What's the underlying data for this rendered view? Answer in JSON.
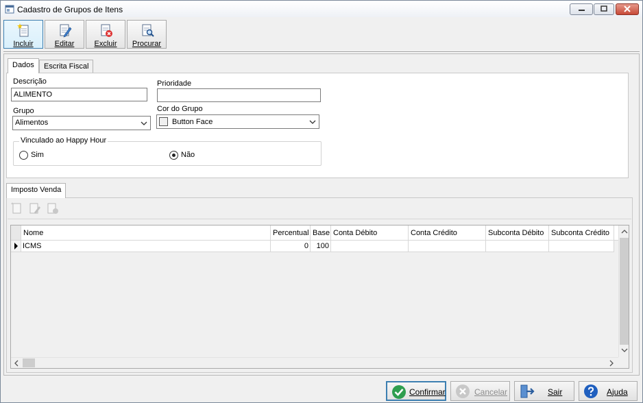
{
  "window": {
    "title": "Cadastro de Grupos de Itens"
  },
  "toolbar": {
    "incluir": "Incluir",
    "editar": "Editar",
    "excluir": "Excluir",
    "procurar": "Procurar"
  },
  "tabs": {
    "dados": "Dados",
    "escrita_fiscal": "Escrita Fiscal"
  },
  "form": {
    "descricao_label": "Descrição",
    "descricao_value": "ALIMENTO",
    "prioridade_label": "Prioridade",
    "prioridade_value": "",
    "grupo_label": "Grupo",
    "grupo_value": "Alimentos",
    "cor_label": "Cor do Grupo",
    "cor_value": "Button Face",
    "happy_hour_label": "Vinculado ao Happy Hour",
    "radio_sim": "Sim",
    "radio_nao": "Não",
    "happy_hour_selected": "Não"
  },
  "imposto_tab": "Imposto Venda",
  "grid": {
    "columns": [
      "Nome",
      "Percentual",
      "Base",
      "Conta Débito",
      "Conta Crédito",
      "Subconta Débito",
      "Subconta Crédito"
    ],
    "rows": [
      {
        "nome": "ICMS",
        "percentual": "0",
        "base": "100",
        "conta_debito": "",
        "conta_credito": "",
        "subconta_debito": "",
        "subconta_credito": ""
      }
    ]
  },
  "buttons": {
    "confirmar": "Confirmar",
    "cancelar": "Cancelar",
    "sair": "Sair",
    "ajuda": "Ajuda"
  },
  "colors": {
    "accent": "#3c7fb1",
    "close_button": "#c74a38",
    "confirm_icon": "#2e9e4f",
    "help_icon": "#1f5fbf"
  }
}
